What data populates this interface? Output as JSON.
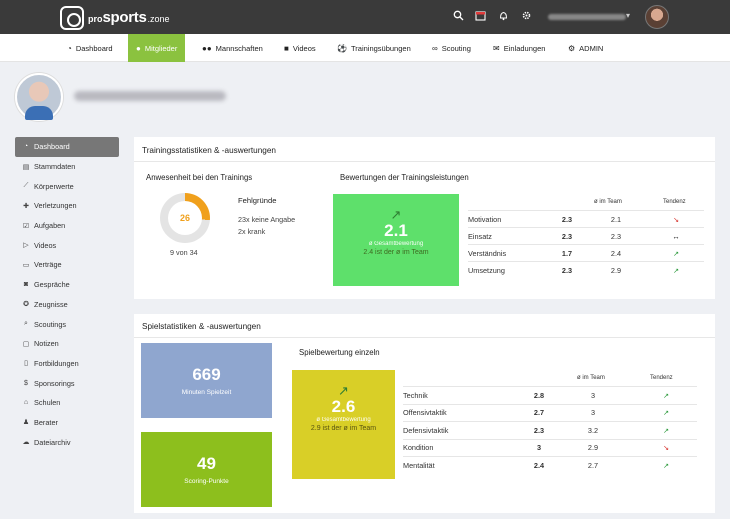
{
  "brand": {
    "pro": "pro",
    "sports": "sports",
    "zone": ".zone"
  },
  "topbar_icons": [
    "search-icon",
    "calendar-icon",
    "bell-icon",
    "gear-icon"
  ],
  "nav": [
    {
      "label": "Dashboard",
      "icon": "dashboard-icon"
    },
    {
      "label": "Mitglieder",
      "icon": "user-icon",
      "active": true
    },
    {
      "label": "Mannschaften",
      "icon": "users-icon"
    },
    {
      "label": "Videos",
      "icon": "video-icon"
    },
    {
      "label": "Trainingsübungen",
      "icon": "ball-icon"
    },
    {
      "label": "Scouting",
      "icon": "binoculars-icon"
    },
    {
      "label": "Einladungen",
      "icon": "mail-icon"
    },
    {
      "label": "ADMIN",
      "icon": "admin-icon"
    }
  ],
  "sidebar": [
    {
      "label": "Dashboard",
      "active": true
    },
    {
      "label": "Stammdaten"
    },
    {
      "label": "Körperwerte"
    },
    {
      "label": "Verletzungen"
    },
    {
      "label": "Aufgaben"
    },
    {
      "label": "Videos"
    },
    {
      "label": "Verträge"
    },
    {
      "label": "Gespräche"
    },
    {
      "label": "Zeugnisse"
    },
    {
      "label": "Scoutings"
    },
    {
      "label": "Notizen"
    },
    {
      "label": "Fortbildungen"
    },
    {
      "label": "Sponsorings"
    },
    {
      "label": "Schulen"
    },
    {
      "label": "Berater"
    },
    {
      "label": "Dateiarchiv"
    }
  ],
  "training": {
    "title": "Trainingsstatistiken & -auswertungen",
    "attendance": {
      "title": "Anwesenheit bei den Trainings",
      "count": "26",
      "fraction": 0.2647,
      "summary": "9 von 34",
      "reasons_title": "Fehlgründe",
      "reasons": [
        "23x keine Angabe",
        "2x krank"
      ]
    },
    "ratings": {
      "title": "Bewertungen der Trainingsleistungen",
      "score": "2.1",
      "score_label": "ø Gesamtbewertung",
      "score_sub": "2.4 ist der ø im Team",
      "col_team": "ø im Team",
      "col_trend": "Tendenz",
      "rows": [
        {
          "name": "Motivation",
          "value": "2.3",
          "team": "2.1",
          "trend": "down"
        },
        {
          "name": "Einsatz",
          "value": "2.3",
          "team": "2.3",
          "trend": "flat"
        },
        {
          "name": "Verständnis",
          "value": "1.7",
          "team": "2.4",
          "trend": "up"
        },
        {
          "name": "Umsetzung",
          "value": "2.3",
          "team": "2.9",
          "trend": "up"
        }
      ]
    }
  },
  "game": {
    "title": "Spielstatistiken & -auswertungen",
    "minutes": {
      "value": "669",
      "label": "Minuten Spielzeit"
    },
    "points": {
      "value": "49",
      "label": "Scoring-Punkte"
    },
    "ratings": {
      "title": "Spielbewertung einzeln",
      "score": "2.6",
      "score_label": "ø Gesamtbewertung",
      "score_sub": "2.9 ist der ø im Team",
      "col_team": "ø im Team",
      "col_trend": "Tendenz",
      "rows": [
        {
          "name": "Technik",
          "value": "2.8",
          "team": "3",
          "trend": "up"
        },
        {
          "name": "Offensivtaktik",
          "value": "2.7",
          "team": "3",
          "trend": "up"
        },
        {
          "name": "Defensivtaktik",
          "value": "2.3",
          "team": "3.2",
          "trend": "up"
        },
        {
          "name": "Kondition",
          "value": "3",
          "team": "2.9",
          "trend": "down"
        },
        {
          "name": "Mentalität",
          "value": "2.4",
          "team": "2.7",
          "trend": "up"
        }
      ]
    }
  },
  "colors": {
    "accent": "#8bc23f",
    "orange": "#f0a01c",
    "green_box": "#5ee06b",
    "blue_box": "#8fa6cf",
    "lime_box": "#8dbf1d",
    "yellow_box": "#d9cf27"
  }
}
